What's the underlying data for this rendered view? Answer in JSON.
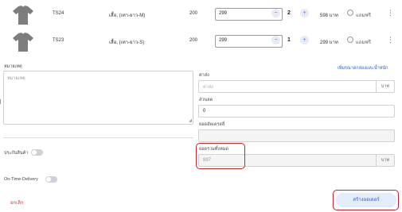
{
  "items": [
    {
      "sku": "TS24",
      "description": "เสื้อ, (เทา-ยาว-M)",
      "qty": "200",
      "price": "299",
      "count": "2",
      "total": "598 บาท",
      "free_label": "แถมฟรี",
      "minus": "−",
      "plus": "+",
      "more": "⋮"
    },
    {
      "sku": "TS23",
      "description": "เสื้อ, (เทา-ยาว-S)",
      "qty": "200",
      "price": "299",
      "count": "1",
      "total": "299 บาท",
      "free_label": "แถมฟรี",
      "minus": "−",
      "plus": "+",
      "more": "⋮"
    }
  ],
  "note": {
    "label": "หมายเหตุ",
    "placeholder": "หมายเหตุ"
  },
  "insurance": {
    "label": "ประกันสินค้า"
  },
  "on_time": {
    "label": "On-Time-Delivery"
  },
  "right": {
    "add_box_link": "เพิ่มขนาดกล่องและน้ำหนัก",
    "shipping": {
      "label": "ค่าส่ง",
      "placeholder": "ค่าส่ง",
      "unit": "บาท"
    },
    "discount": {
      "label": "ส่วนลด",
      "value": "0"
    },
    "vat": {
      "label": "ยอดอัพเดรลลี่",
      "value": ""
    },
    "grand_total": {
      "label": "ยอดรวมทั้งหมด",
      "value": "897",
      "unit": "บาท"
    }
  },
  "actions": {
    "cancel": "ยกเลิก",
    "submit": "สร้างออเดอร์"
  },
  "colors": {
    "accent": "#3358c6",
    "highlight": "#d41f24",
    "cancel": "#dd3333",
    "button_bg": "#e3ecfb"
  }
}
